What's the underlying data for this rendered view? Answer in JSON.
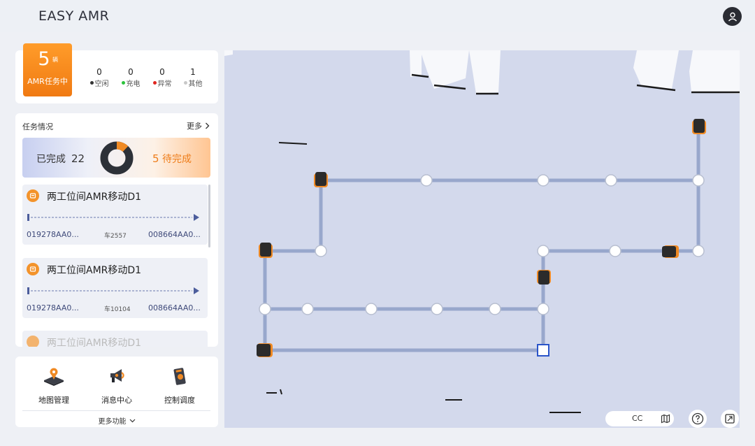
{
  "header": {
    "title": "EASY AMR"
  },
  "stats": {
    "active_count": "5",
    "active_unit": "辆",
    "active_label": "AMR任务中",
    "items": [
      {
        "value": "0",
        "label": "空闲",
        "color": "#333333"
      },
      {
        "value": "0",
        "label": "充电",
        "color": "#2bc33b"
      },
      {
        "value": "0",
        "label": "异常",
        "color": "#e0261f"
      },
      {
        "value": "1",
        "label": "其他",
        "color": "#c8c8c8"
      }
    ]
  },
  "tasks": {
    "title": "任务情况",
    "more": "更多",
    "completed_label": "已完成",
    "completed_value": "22",
    "pending_value": "5",
    "pending_label": "待完成",
    "list": [
      {
        "name": "两工位间AMR移动D1",
        "from": "019278AA0...",
        "car": "车2557",
        "to": "008664AA0..."
      },
      {
        "name": "两工位间AMR移动D1",
        "from": "019278AA0...",
        "car": "车10104",
        "to": "008664AA0..."
      },
      {
        "name": "两工位间AMR移动D1"
      }
    ]
  },
  "functions": {
    "items": [
      {
        "label": "地图管理",
        "icon": "map-management-icon"
      },
      {
        "label": "消息中心",
        "icon": "megaphone-icon"
      },
      {
        "label": "控制调度",
        "icon": "remote-control-icon"
      }
    ],
    "more": "更多功能"
  },
  "map": {
    "zone_label": "CC",
    "colors": {
      "path": "#98a7cc",
      "robot": "#2b2b2b",
      "robot_accent": "#f08a24",
      "target": "#2a54c9"
    }
  }
}
